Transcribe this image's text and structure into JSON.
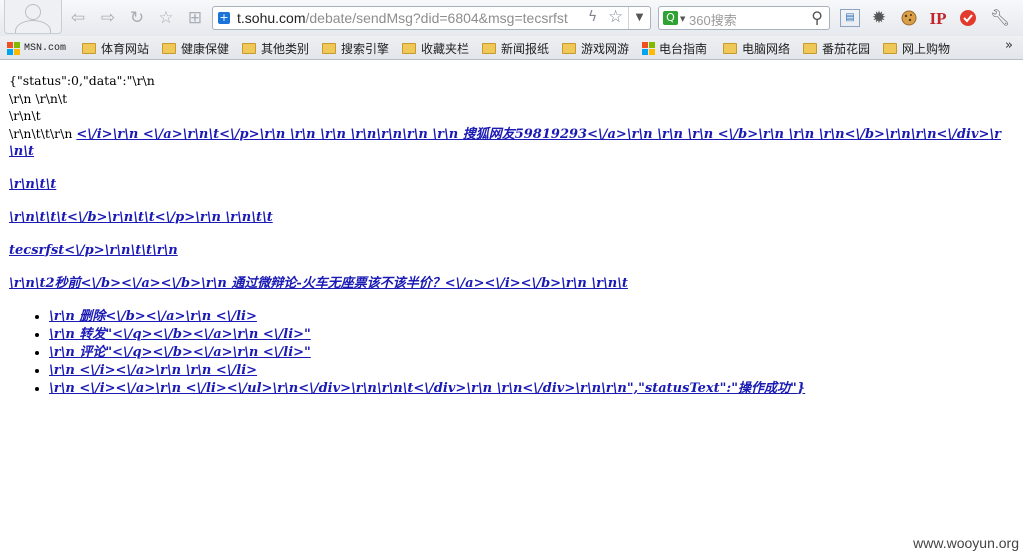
{
  "browser": {
    "address_host": "t.sohu.com",
    "address_path": "/debate/sendMsg?did=6804&msg=tecsrfst",
    "search_placeholder": "360搜索",
    "icons": [
      "back-icon",
      "forward-icon",
      "reload-icon",
      "undo-icon",
      "favorite-icon",
      "tiles-icon",
      "bolt-icon",
      "star-icon",
      "search-icon",
      "translate-icon",
      "gear-icon",
      "cookie-icon",
      "ip-icon",
      "stop-icon",
      "wrench-icon"
    ]
  },
  "bookmarks": {
    "items": [
      {
        "label": "MSN.com",
        "icon": "msn-icon"
      },
      {
        "label": "体育网站",
        "icon": "folder-icon"
      },
      {
        "label": "健康保健",
        "icon": "folder-icon"
      },
      {
        "label": "其他类别",
        "icon": "folder-icon"
      },
      {
        "label": "搜索引擎",
        "icon": "folder-icon"
      },
      {
        "label": "收藏夹栏",
        "icon": "folder-icon"
      },
      {
        "label": "新闻报纸",
        "icon": "folder-icon"
      },
      {
        "label": "游戏网游",
        "icon": "folder-icon"
      },
      {
        "label": "电台指南",
        "icon": "windows-icon"
      },
      {
        "label": "电脑网络",
        "icon": "folder-icon"
      },
      {
        "label": "番茄花园",
        "icon": "folder-icon"
      },
      {
        "label": "网上购物",
        "icon": "folder-icon"
      }
    ],
    "more": "»"
  },
  "page": {
    "lines": [
      "{\"status\":0,\"data\":\"\\r\\n",
      "\\r\\n \\r\\n\\t",
      "\\r\\n\\t",
      "",
      "\\r\\n\\t\\t\\r\\n "
    ],
    "link1": "<\\/i>\\r\\n <\\/a>\\r\\n\\t<\\/p>\\r\\n \\r\\n \\r\\n \\r\\n\\r\\n\\r\\n \\r\\n 搜狐网友59819293<\\/a>\\r\\n \\r\\n \\r\\n <\\/b>\\r\\n \\r\\n \\r\\n<\\/b>\\r\\n\\r\\n<\\/div>\\r\\n\\t",
    "link2": "\\r\\n\\t\\t",
    "link3": "\\r\\n\\t\\t\\t<\\/b>\\r\\n\\t\\t<\\/p>\\r\\n \\r\\n\\t\\t",
    "link4": "tecsrfst<\\/p>\\r\\n\\t\\t\\r\\n",
    "link5": "\\r\\n\\t2秒前<\\/b><\\/a><\\/b>\\r\\n 通过微辩论-火车无座票该不该半价？<\\/a><\\/i><\\/b>\\r\\n \\r\\n\\t",
    "list": [
      "\\r\\n 删除<\\/b><\\/a>\\r\\n <\\/li>",
      "\\r\\n 转发\"<\\/q><\\/b><\\/a>\\r\\n <\\/li>\"",
      "\\r\\n 评论\"<\\/q><\\/b><\\/a>\\r\\n <\\/li>\"",
      "\\r\\n <\\/i><\\/a>\\r\\n \\r\\n <\\/li>",
      "\\r\\n <\\/i><\\/a>\\r\\n <\\/li><\\/ul>\\r\\n<\\/div>\\r\\n\\r\\n\\t<\\/div>\\r\\n \\r\\n<\\/div>\\r\\n\\r\\n\",\"statusText\":\"操作成功\"}"
    ]
  },
  "watermark": "www.wooyun.org"
}
